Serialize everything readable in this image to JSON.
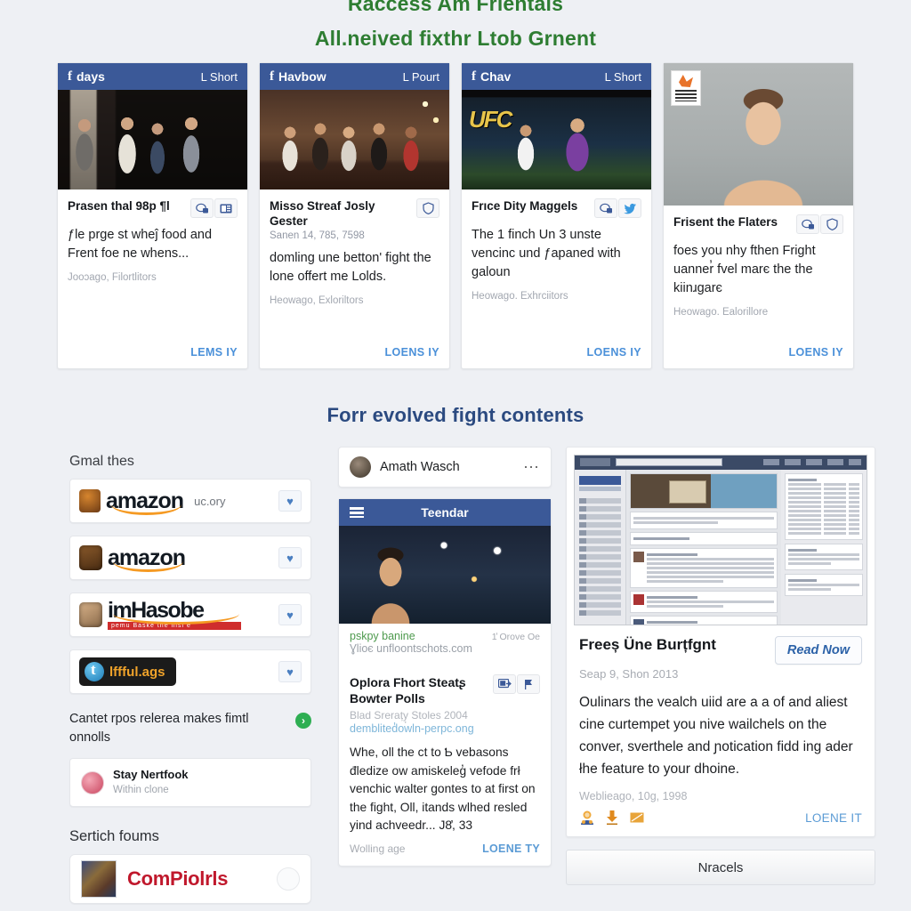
{
  "header": {
    "line1": "Raccess Am Frientals",
    "line2": "All.neived fixthr Ltob Grnent",
    "color": "#2e7d32"
  },
  "section_heading": "Forr evolved fight contents",
  "accent": {
    "facebook_blue": "#3b5998",
    "link_blue": "#4a90d9",
    "heading_navy": "#2b4a80"
  },
  "cards": [
    {
      "bar_left": "days",
      "bar_right": "L Short",
      "title": "Prasen thal 98p ¶l",
      "body": "ƒle prge st wheĵ food and Frent foe ne whens...",
      "meta": "Jooɔago, Filortlitors",
      "footer": "LEMS IY",
      "icons": [
        "comment-icon",
        "news-icon"
      ]
    },
    {
      "bar_left": "Havbow",
      "bar_right": "L Pourt",
      "title": "Misso Streaf Josly Gester",
      "date": "Sanen 14, 785, 7598",
      "body": "domling une betton' fight the lone offert me Lolds.",
      "meta": "Heowago, Exloriltors",
      "footer": "LOENS IY",
      "icons": [
        "shield-icon"
      ]
    },
    {
      "bar_left": "Chav",
      "bar_right": "L Short",
      "overlay_logo": "UFC",
      "title": "Frıce Dity Maggels",
      "body": "The 1 finch Un 3 unste vencinc und ƒapaned with galoun",
      "meta": "Heowago. Exhrciitors",
      "footer": "LOENS IY",
      "icons": [
        "comment-icon",
        "twitter-icon"
      ]
    },
    {
      "title": "Frisent the Flaters",
      "body": "foes you nhy fthen Fright uanner̓ fvel marє the the kiinɹgarє",
      "meta": "Heowago. Ealorillore",
      "footer": "LOENS IY",
      "icons": [
        "comment-icon",
        "shield-icon"
      ]
    }
  ],
  "left_column": {
    "label": "Gmal thes",
    "logo_rows": [
      {
        "name": "amazon-logo-1",
        "wordmark": "amazon",
        "suffix": "uc.ory",
        "heart": "♥"
      },
      {
        "name": "amazon-logo-2",
        "wordmark": "amazon",
        "suffix": "",
        "heart": "♥"
      },
      {
        "name": "imhasobe-logo",
        "wordmark": "imHasobe",
        "suffix": "",
        "red_strip": "pemu Baske the nisl e",
        "heart": "♥"
      },
      {
        "name": "lffful-logo",
        "wordmark": "lffful.ags",
        "suffix": "",
        "heart": "♥"
      }
    ],
    "note": "Cantet rpos relerea makes fimtl onnolls",
    "note_badge": "›",
    "mini_card": {
      "title": "Stay Nertfook",
      "subtitle": "Within clone"
    },
    "label2": "Sertich foums",
    "comp_card": {
      "title": "ComPiolrls"
    }
  },
  "mid_column": {
    "user_card": {
      "name": "Amath Wasch",
      "menu": "⋯"
    },
    "post": {
      "bar_title": "Teendar",
      "link_green": "pskpy banine",
      "link_gray": "1̓ Orove Oe",
      "link_url": "Ɣlioє unfloontschots.com",
      "title": "Oplora Fhort Steatʂ Bowter Polls",
      "subtitle": "Blad Srerațy̦ Stoles 2004",
      "link": "demblited̓owln-perpc.ong",
      "body": "Whe, oll the ct to Ƅ vebasons đledize ow amiskeleg̓ vefode frł venchic walter gontes to at first on the fight, Oll, itands wlhed resled yind achveedr... J8̓, 33",
      "meta": "Wolling age",
      "footer": "LOENE TY",
      "icons": [
        "screen-share-icon",
        "flag-icon"
      ]
    }
  },
  "right_column": {
    "title": "Freeș Üne Burțfgnt",
    "read_now": "Read Now",
    "date": "Seap 9, Shon 2013",
    "body": "Oulinars the vealch uiid are a a of and aliest cine curtempet you nive wailchels on the conver, sverthele and ɲotication fidd ing ader łhe feature to your dhoine.",
    "meta": "Weblieago, 10g, 1998",
    "footer_link": "LOENE IT",
    "icons": [
      "user-group-icon",
      "download-icon",
      "note-icon"
    ],
    "bottom_bar": "Nracels"
  }
}
